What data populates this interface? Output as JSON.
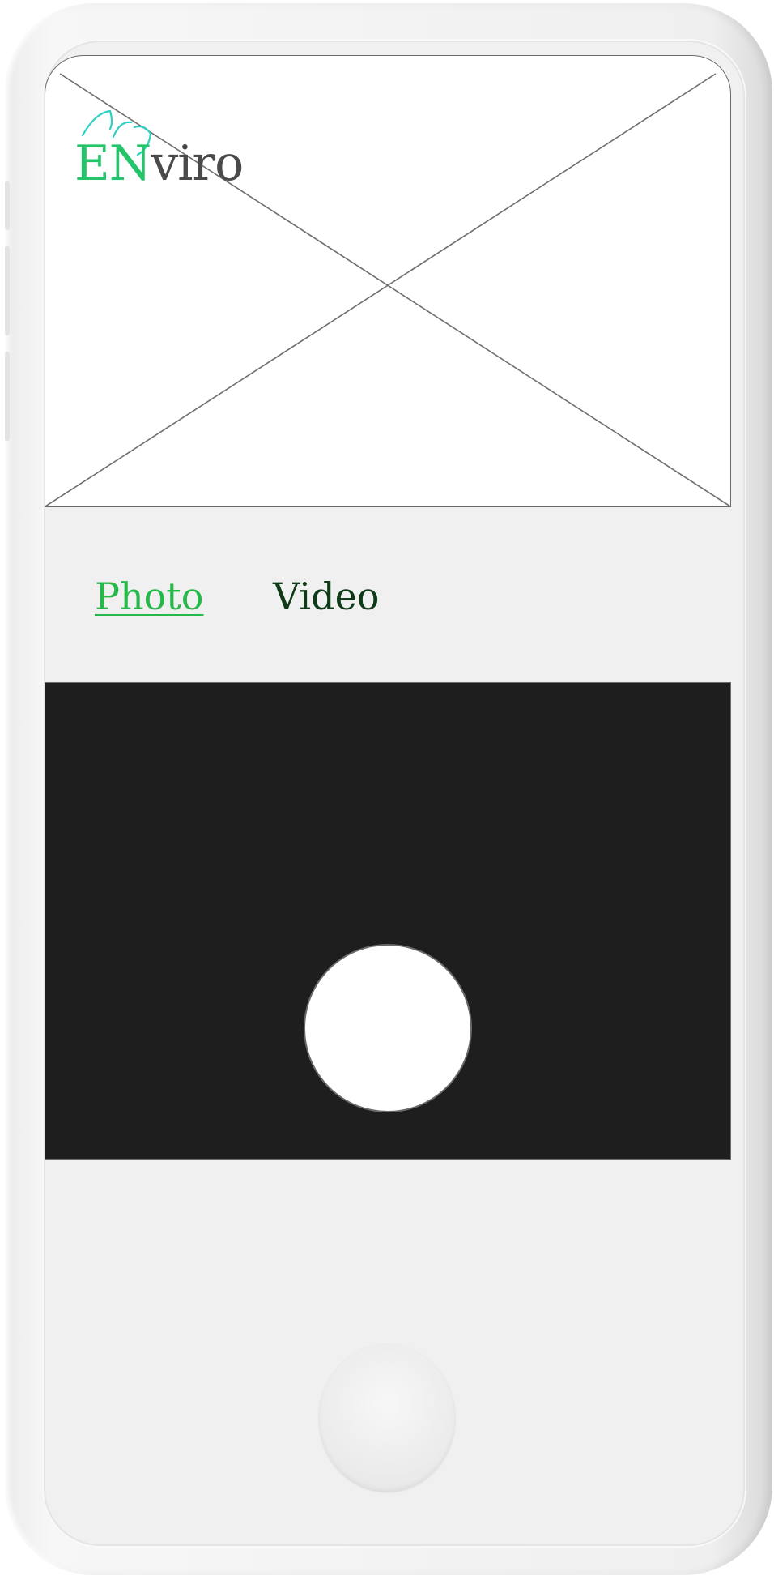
{
  "app": {
    "logo": {
      "part1": "EN",
      "part2": "viro",
      "icon": "leaf-icon"
    }
  },
  "tabs": [
    {
      "label": "Photo",
      "active": true
    },
    {
      "label": "Video",
      "active": false
    }
  ],
  "camera": {
    "shutter_icon": "shutter-button-icon"
  },
  "device": {
    "home_button_icon": "home-button-icon"
  },
  "colors": {
    "brand_green": "#23c46a",
    "active_tab": "#27b84a",
    "inactive_tab": "#0f3a18",
    "viewfinder": "#1e1e1e",
    "logo_leaves": "#2fcfc4"
  }
}
